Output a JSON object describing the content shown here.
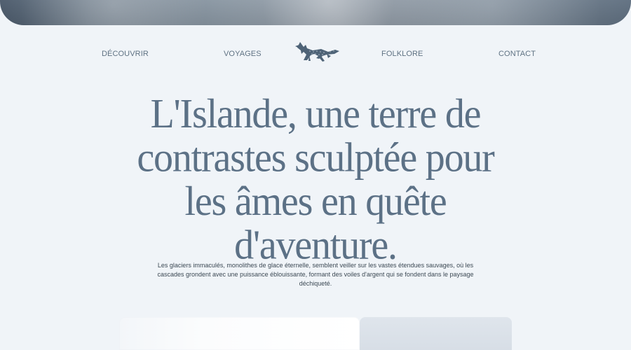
{
  "nav": {
    "links": [
      {
        "label": "DÉCOUVRIR"
      },
      {
        "label": "VOYAGES"
      },
      {
        "label": "FOLKLORE"
      },
      {
        "label": "CONTACT"
      }
    ],
    "logo_icon": "fox-icon"
  },
  "hero": {
    "headline_lines": [
      "L'Islande, une terre de",
      "contrastes sculptée pour",
      "les âmes en quête",
      "d'aventure."
    ],
    "description": "Les glaciers immaculés, monolithes de glace éternelle, semblent veiller sur les vastes étendues sauvages, où les cascades grondent avec une puissance éblouissante, formant des voiles d'argent qui se fondent dans le paysage déchiqueté."
  },
  "colors": {
    "page_background": "#f0f4f8",
    "accent": "#5c7186",
    "body_text": "#3c4954"
  }
}
